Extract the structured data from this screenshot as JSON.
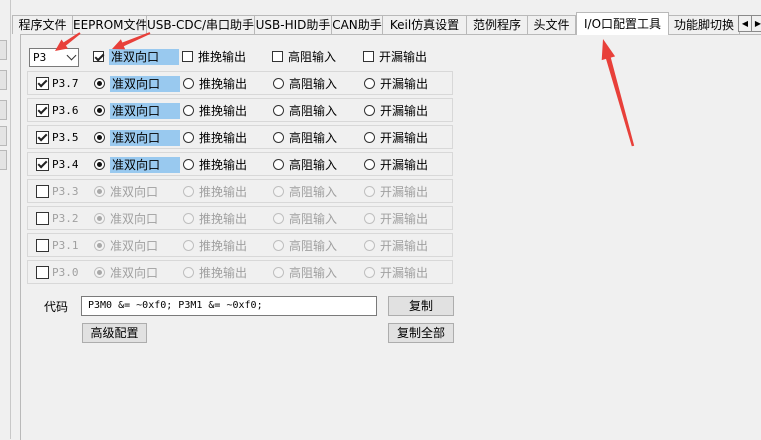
{
  "tabs": [
    {
      "label": "程序文件",
      "active": false
    },
    {
      "label": "EEPROM文件",
      "active": false
    },
    {
      "label": "USB-CDC/串口助手",
      "active": false
    },
    {
      "label": "USB-HID助手",
      "active": false
    },
    {
      "label": "CAN助手",
      "active": false
    },
    {
      "label": "Keil仿真设置",
      "active": false
    },
    {
      "label": "范例程序",
      "active": false
    },
    {
      "label": "头文件",
      "active": false
    },
    {
      "label": "I/O口配置工具",
      "active": true
    },
    {
      "label": "功能脚切换",
      "active": false
    }
  ],
  "port_select": {
    "value": "P3"
  },
  "header_row": {
    "all_checked": true,
    "options": [
      "准双向口",
      "推挽输出",
      "高阻输入",
      "开漏输出"
    ],
    "checked": [
      true,
      false,
      false,
      false
    ]
  },
  "pins": [
    {
      "label": "P3.7",
      "enabled": true,
      "mode_index": 0
    },
    {
      "label": "P3.6",
      "enabled": true,
      "mode_index": 0
    },
    {
      "label": "P3.5",
      "enabled": true,
      "mode_index": 0
    },
    {
      "label": "P3.4",
      "enabled": true,
      "mode_index": 0
    },
    {
      "label": "P3.3",
      "enabled": false,
      "mode_index": 0
    },
    {
      "label": "P3.2",
      "enabled": false,
      "mode_index": 0
    },
    {
      "label": "P3.1",
      "enabled": false,
      "mode_index": 0
    },
    {
      "label": "P3.0",
      "enabled": false,
      "mode_index": 0
    }
  ],
  "mode_options": [
    "准双向口",
    "推挽输出",
    "高阻输入",
    "开漏输出"
  ],
  "code": {
    "label": "代码",
    "value": "P3M0 &= ~0xf0; P3M1 &= ~0xf0;"
  },
  "buttons": {
    "copy": "复制",
    "advanced": "高级配置",
    "copy_all": "复制全部"
  },
  "annotation_color": "#e8403a"
}
